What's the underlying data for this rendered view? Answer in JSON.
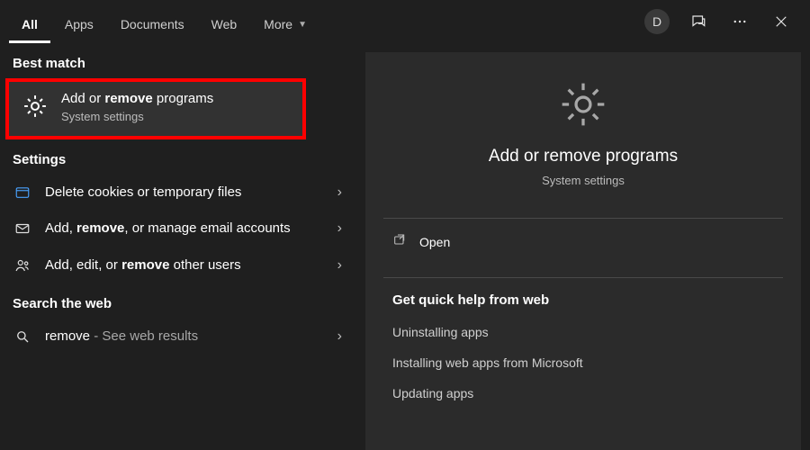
{
  "tabs": {
    "all": "All",
    "apps": "Apps",
    "documents": "Documents",
    "web": "Web",
    "more": "More",
    "active": "all"
  },
  "account": {
    "initial": "D"
  },
  "left": {
    "best_match_label": "Best match",
    "best_match": {
      "title_prefix": "Add or ",
      "title_bold": "remove",
      "title_suffix": " programs",
      "subtitle": "System settings"
    },
    "settings_label": "Settings",
    "settings": [
      {
        "icon": "cookies-icon",
        "prefix": "Delete ",
        "bold": "",
        "suffix": "cookies or temporary files"
      },
      {
        "icon": "mail-icon",
        "prefix": "Add, ",
        "bold": "remove",
        "suffix": ", or manage email accounts"
      },
      {
        "icon": "users-icon",
        "prefix": "Add, edit, or ",
        "bold": "remove",
        "suffix": " other users"
      }
    ],
    "web_label": "Search the web",
    "web": {
      "query": "remove",
      "hint": "See web results"
    }
  },
  "right": {
    "title": "Add or remove programs",
    "subtitle": "System settings",
    "open": "Open",
    "help_header": "Get quick help from web",
    "help_items": [
      "Uninstalling apps",
      "Installing web apps from Microsoft",
      "Updating apps"
    ]
  }
}
